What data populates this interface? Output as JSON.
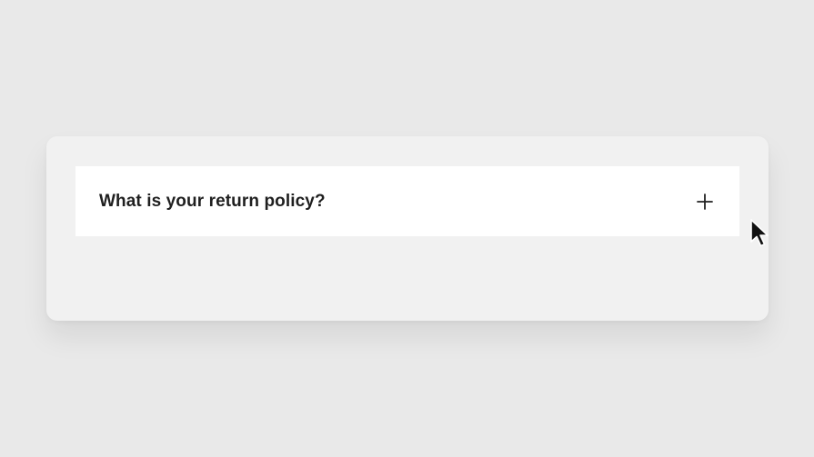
{
  "faq": {
    "items": [
      {
        "question": "What is your return policy?",
        "expanded": false,
        "toggle_icon": "plus-icon"
      }
    ]
  },
  "cursor": {
    "icon": "mouse-pointer-icon"
  },
  "colors": {
    "page_background": "#e9e9e9",
    "panel_background": "#f1f1f1",
    "item_background": "#ffffff",
    "text": "#1f1f1f"
  }
}
